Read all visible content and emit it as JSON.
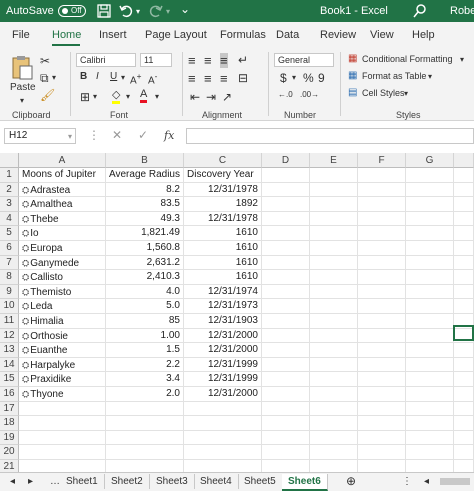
{
  "titlebar": {
    "autosave_label": "AutoSave",
    "autosave_state": "Off",
    "doc_title": "Book1 - Excel",
    "user": "Rober"
  },
  "tabs": [
    "File",
    "Home",
    "Insert",
    "Page Layout",
    "Formulas",
    "Data",
    "Review",
    "View",
    "Help"
  ],
  "active_tab": "Home",
  "ribbon": {
    "clipboard": {
      "paste_label": "Paste",
      "group_label": "Clipboard"
    },
    "font": {
      "name": "Calibri",
      "size": "11",
      "group_label": "Font"
    },
    "alignment": {
      "group_label": "Alignment"
    },
    "number": {
      "format": "General",
      "group_label": "Number"
    },
    "styles": {
      "conditional": "Conditional Formatting",
      "table": "Format as Table",
      "cell_styles": "Cell Styles",
      "group_label": "Styles"
    }
  },
  "formula_bar": {
    "name_box": "H12",
    "fx": "fx",
    "content": ""
  },
  "columns": [
    "A",
    "B",
    "C",
    "D",
    "E",
    "F",
    "G"
  ],
  "rows": [
    [
      "Moons of Jupiter",
      "Average Radius",
      "Discovery Year"
    ],
    [
      "Adrastea",
      "8.2",
      "12/31/1978"
    ],
    [
      "Amalthea",
      "83.5",
      "1892"
    ],
    [
      "Thebe",
      "49.3",
      "12/31/1978"
    ],
    [
      "Io",
      "1,821.49",
      "1610"
    ],
    [
      "Europa",
      "1,560.8",
      "1610"
    ],
    [
      "Ganymede",
      "2,631.2",
      "1610"
    ],
    [
      "Callisto",
      "2,410.3",
      "1610"
    ],
    [
      "Themisto",
      "4.0",
      "12/31/1974"
    ],
    [
      "Leda",
      "5.0",
      "12/31/1973"
    ],
    [
      "Himalia",
      "85",
      "12/31/1903"
    ],
    [
      "Orthosie",
      "1.00",
      "12/31/2000"
    ],
    [
      "Euanthe",
      "1.5",
      "12/31/2000"
    ],
    [
      "Harpalyke",
      "2.2",
      "12/31/1999"
    ],
    [
      "Praxidike",
      "3.4",
      "12/31/1999"
    ],
    [
      "Thyone",
      "2.0",
      "12/31/2000"
    ]
  ],
  "row_count": 21,
  "sheets": [
    "Sheet1",
    "Sheet2",
    "Sheet3",
    "Sheet4",
    "Sheet5",
    "Sheet6"
  ],
  "active_sheet": "Sheet6",
  "colors": {
    "accent": "#217346",
    "ribbon_bg": "#f3f3f3",
    "font_color": "#e81123",
    "highlight": "#ffff00"
  }
}
